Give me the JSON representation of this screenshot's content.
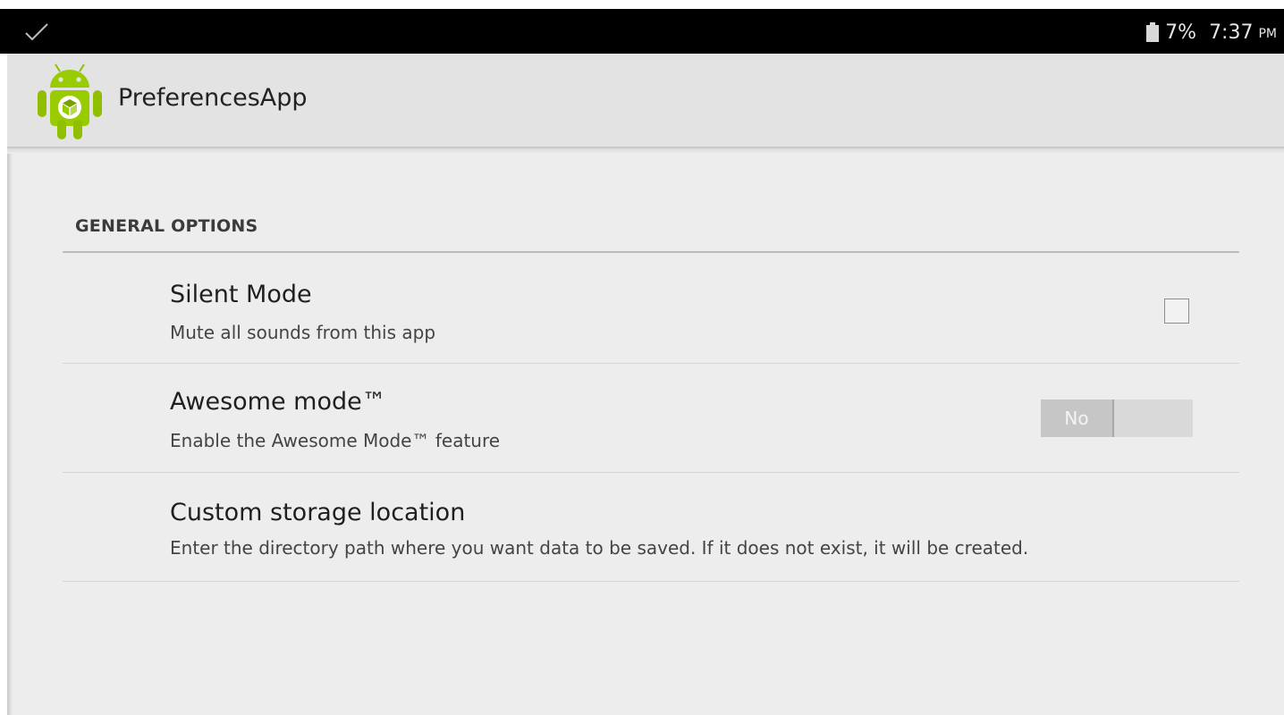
{
  "status_bar": {
    "notification_icon": "check-icon",
    "battery_icon": "battery-icon",
    "battery_level": "7%",
    "time": "7:37",
    "ampm": "PM"
  },
  "action_bar": {
    "app_icon": "android-robot-icon",
    "title": "PreferencesApp"
  },
  "preferences": {
    "category_title": "GENERAL OPTIONS",
    "items": [
      {
        "title": "Silent Mode",
        "summary": "Mute all sounds from this app",
        "widget": "checkbox",
        "checked": false
      },
      {
        "title": "Awesome mode™",
        "summary": "Enable the Awesome Mode™ feature",
        "widget": "switch",
        "switch_label": "No",
        "on": false
      },
      {
        "title": "Custom storage location",
        "summary": "Enter the directory path where you want data to be saved. If it does not exist, it will be created.",
        "widget": "none"
      }
    ]
  },
  "colors": {
    "status_bar": "#000000",
    "action_bar": "#e3e3e3",
    "background": "#ededed",
    "android_green": "#99cc00"
  }
}
